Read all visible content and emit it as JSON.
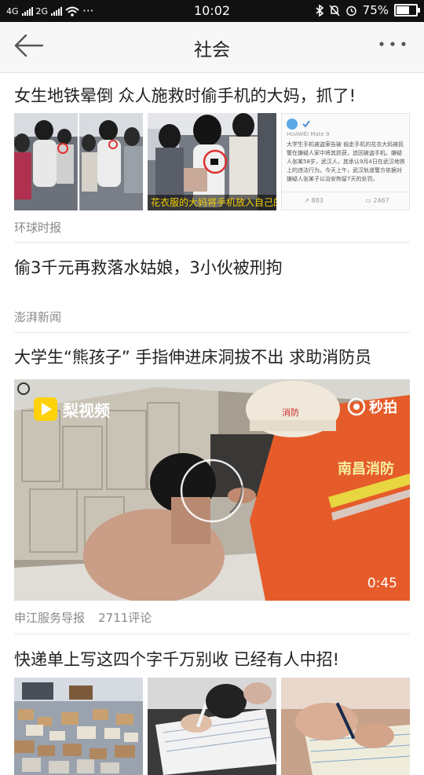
{
  "status_bar": {
    "signal_left": "4G",
    "signal_right": "2G",
    "more": "···",
    "time": "10:02",
    "battery": "75%",
    "battery_level": 0.75
  },
  "header": {
    "title": "社会"
  },
  "articles": [
    {
      "headline": "女生地铁晕倒 众人施救时偷手机的大妈，抓了!",
      "source": "环球时报",
      "image_caption": "花衣服的大妈将手机放入自己的包",
      "weibo_card": {
        "device": "HUAWEI Mate 9",
        "text": "大学生手机被盗案告破 偷走手机的花衣大妈被民警在嫌疑人家中将其抓获，追回被盗手机。嫌疑人张某58岁，武汉人，其承认9月4日在武汉地铁上的违法行为。今天上午，武汉轨道警方依据对嫌疑人张某子以治安拘留7天的处罚。",
        "reposts": "883",
        "comments": "2467"
      }
    },
    {
      "headline": "偷3千元再救落水姑娘，3小伙被刑拘",
      "source": "澎湃新闻"
    },
    {
      "headline": "大学生“熊孩子” 手指伸进床洞拔不出 求助消防员",
      "source": "申江服务导报",
      "comments": "2711评论",
      "video": {
        "duration": "0:45",
        "logo_left": "梨视频",
        "logo_right": "秒拍",
        "helmet_text": "消防",
        "vest_text": "南昌消防"
      }
    },
    {
      "headline": "快递单上写这四个字千万别收 已经有人中招!"
    }
  ]
}
